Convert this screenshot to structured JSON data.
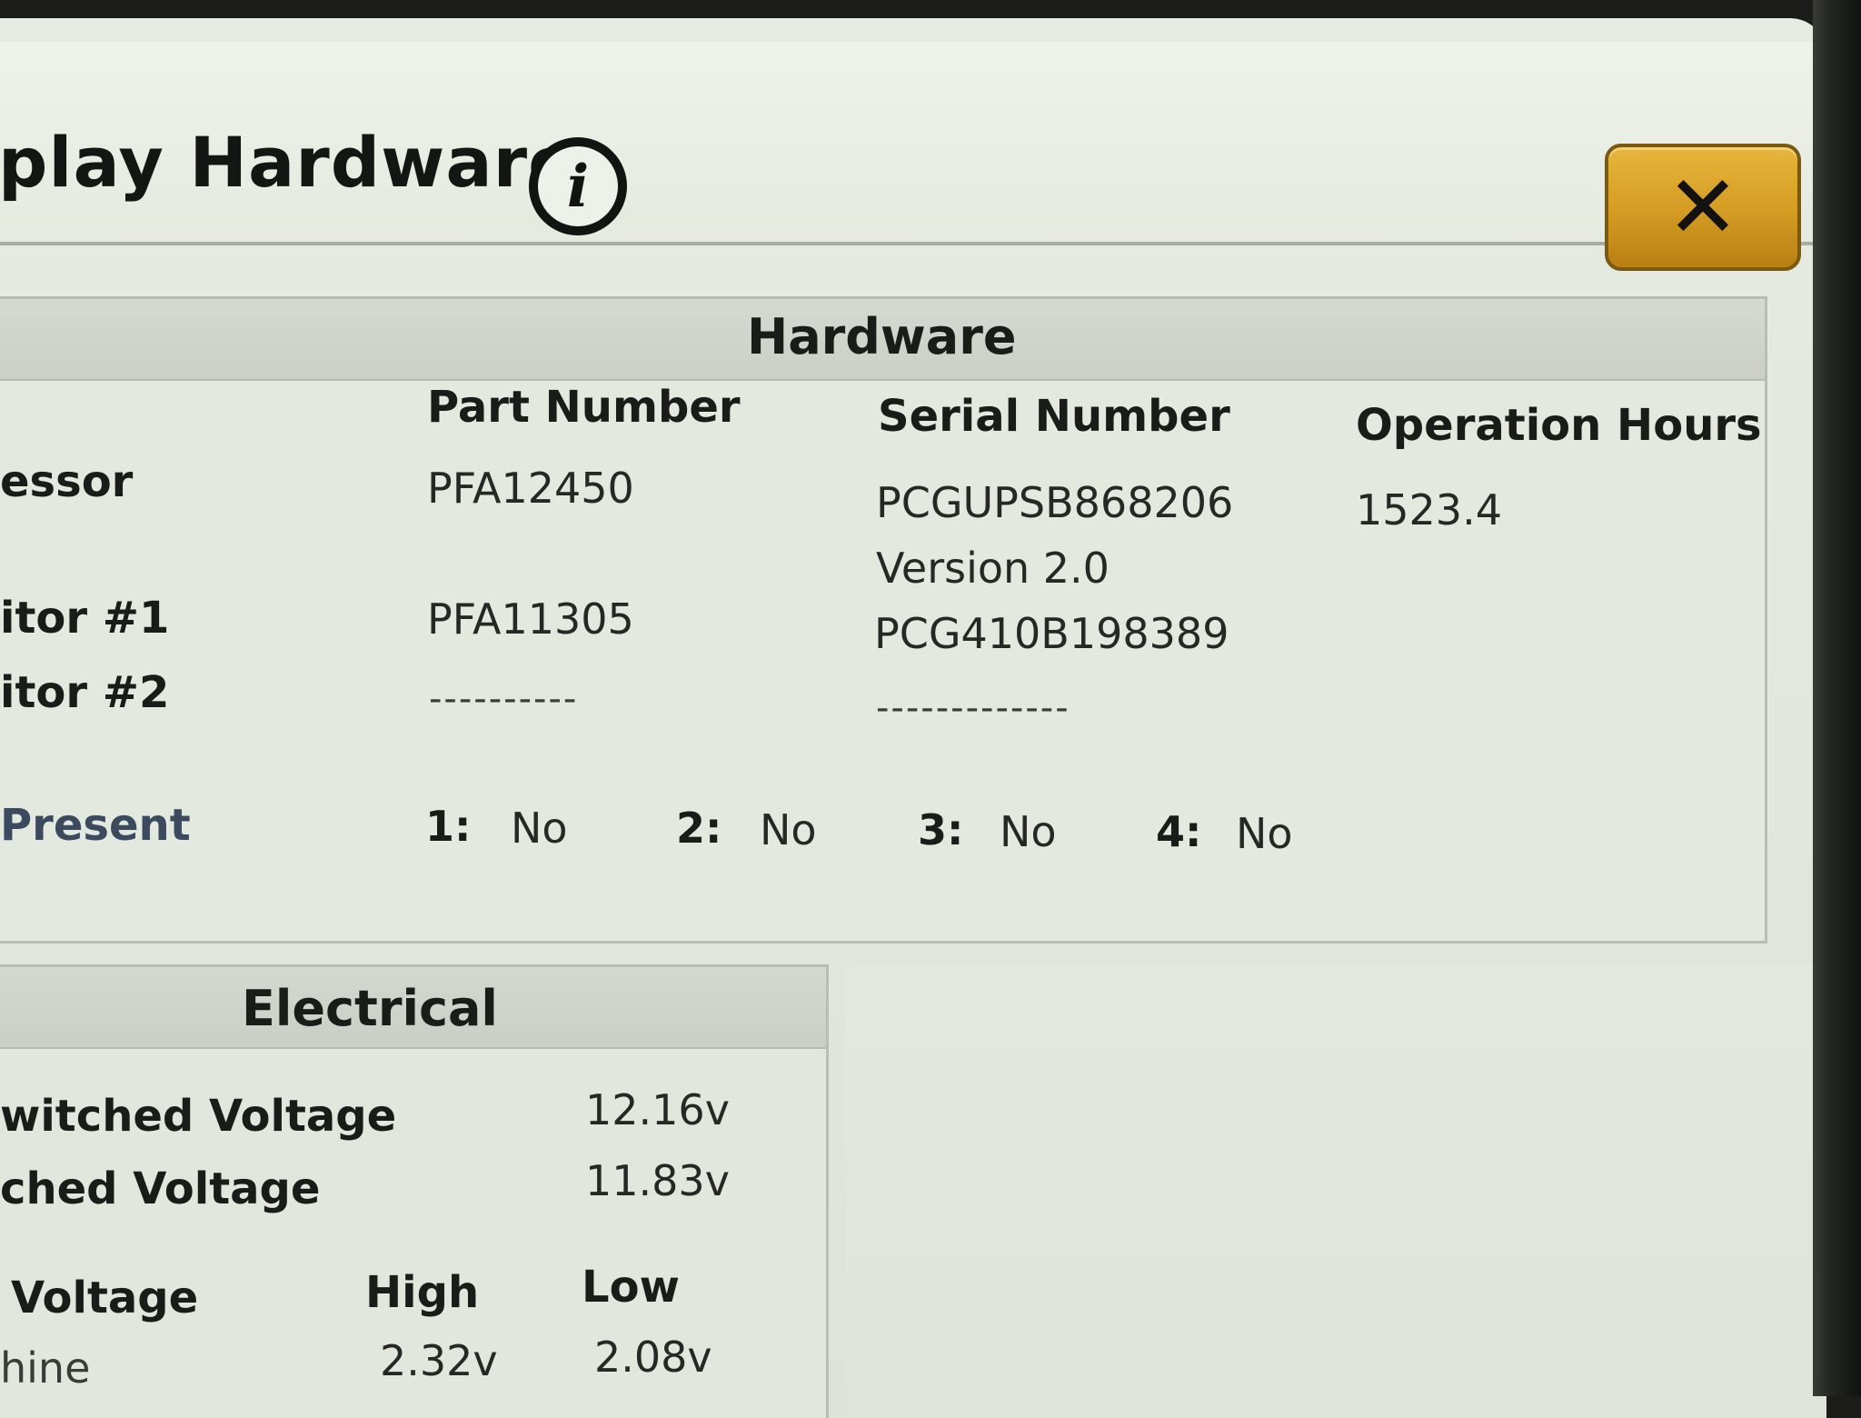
{
  "window": {
    "title": "play Hardware",
    "close_symbol": "✕",
    "info_symbol": "i"
  },
  "hardware": {
    "header": "Hardware",
    "columns": [
      "Part Number",
      "Serial Number",
      "Operation Hours"
    ],
    "rows": [
      {
        "label": "essor",
        "part": "PFA12450",
        "serial": "PCGUPSB868206",
        "hours": "1523.4"
      },
      {
        "label": "",
        "part": "",
        "serial": "Version 2.0",
        "hours": ""
      },
      {
        "label": "itor #1",
        "part": "PFA11305",
        "serial": "PCG410B198389",
        "hours": ""
      },
      {
        "label": "itor #2",
        "part": "----------",
        "serial": "-------------",
        "hours": ""
      }
    ],
    "present": {
      "label": "Present",
      "slots": [
        {
          "num": "1:",
          "value": "No"
        },
        {
          "num": "2:",
          "value": "No"
        },
        {
          "num": "3:",
          "value": "No"
        },
        {
          "num": "4:",
          "value": "No"
        }
      ]
    }
  },
  "electrical": {
    "header": "Electrical",
    "rows": [
      {
        "label": "witched Voltage",
        "value": "12.16v"
      },
      {
        "label": "ched Voltage",
        "value": "11.83v"
      }
    ],
    "table": {
      "label": "Voltage",
      "high_label": "High",
      "low_label": "Low",
      "rows": [
        {
          "label": "hine",
          "high": "2.32v",
          "low": "2.08v"
        }
      ]
    }
  }
}
